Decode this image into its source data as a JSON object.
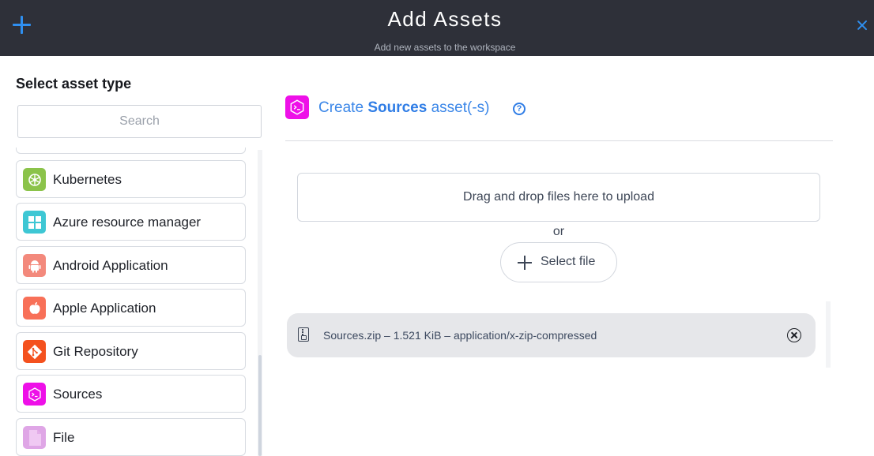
{
  "header": {
    "title": "Add Assets",
    "subtitle": "Add new assets to the workspace"
  },
  "sidebar": {
    "title": "Select asset type",
    "search_placeholder": "Search",
    "items": [
      {
        "label": "Kubernetes",
        "icon": "kubernetes-icon",
        "color": "#8bc34a"
      },
      {
        "label": "Azure resource manager",
        "icon": "windows-icon",
        "color": "#3ec7d4"
      },
      {
        "label": "Android Application",
        "icon": "android-icon",
        "color": "#f3897c"
      },
      {
        "label": "Apple Application",
        "icon": "apple-icon",
        "color": "#f87058"
      },
      {
        "label": "Git Repository",
        "icon": "git-icon",
        "color": "#f4511e"
      },
      {
        "label": "Sources",
        "icon": "sources-icon",
        "color": "#ee10e8"
      },
      {
        "label": "File",
        "icon": "file-icon",
        "color": "#dfa6e6"
      }
    ]
  },
  "main": {
    "create_prefix": "Create",
    "create_type": "Sources",
    "create_suffix": "asset(-s)",
    "help": "?",
    "dropzone_text": "Drag and drop files here to upload",
    "or_text": "or",
    "select_file_label": "Select file",
    "files": [
      {
        "name": "Sources.zip",
        "size": "1.521 KiB",
        "mime": "application/x-zip-compressed",
        "display": "Sources.zip  –  1.521 KiB  –  application/x-zip-compressed"
      }
    ]
  }
}
